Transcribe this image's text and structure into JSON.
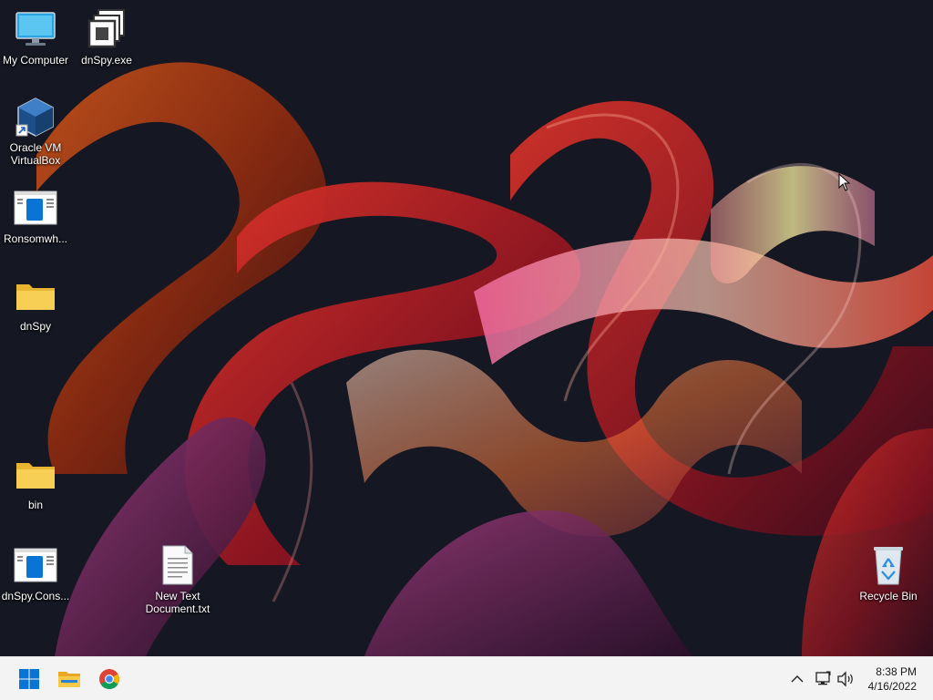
{
  "desktop": {
    "icons": [
      {
        "label": "My Computer",
        "icon": "monitor-icon"
      },
      {
        "label": "dnSpy.exe",
        "icon": "dnspy-app-icon"
      },
      {
        "label": "Oracle VM\nVirtualBox",
        "icon": "virtualbox-icon"
      },
      {
        "label": "Ronsomwh...",
        "icon": "application-window-icon"
      },
      {
        "label": "dnSpy",
        "icon": "folder-icon"
      },
      {
        "label": "bin",
        "icon": "folder-icon"
      },
      {
        "label": "dnSpy.Cons...",
        "icon": "application-window-icon"
      },
      {
        "label": "New Text\nDocument.txt",
        "icon": "text-document-icon"
      },
      {
        "label": "Recycle Bin",
        "icon": "recycle-bin-icon"
      }
    ]
  },
  "taskbar": {
    "pinned": [
      {
        "name": "Start",
        "icon": "windows-logo-icon"
      },
      {
        "name": "File Explorer",
        "icon": "file-explorer-icon"
      },
      {
        "name": "Google Chrome",
        "icon": "chrome-icon"
      }
    ],
    "tray": [
      {
        "name": "Show hidden icons",
        "icon": "chevron-up-icon"
      },
      {
        "name": "Network",
        "icon": "network-icon"
      },
      {
        "name": "Volume",
        "icon": "speaker-icon"
      }
    ],
    "clock": {
      "time": "8:38 PM",
      "date": "4/16/2022"
    }
  },
  "colors": {
    "wallpaper_bg": "#141621",
    "taskbar_bg": "#f3f3f3",
    "folder_yellow": "#f5c842",
    "windows_blue": "#0a74d4"
  }
}
